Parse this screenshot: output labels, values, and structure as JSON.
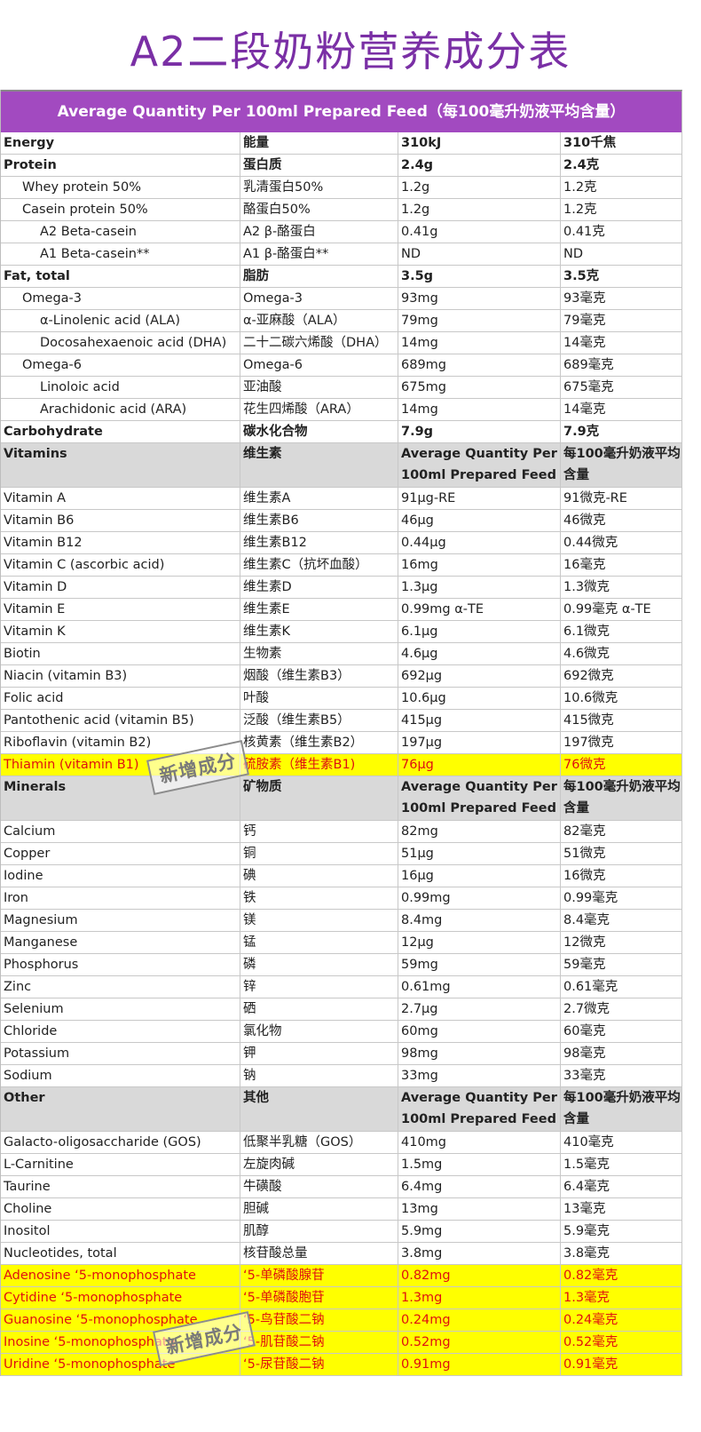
{
  "title": "A2二段奶粉营养成分表",
  "header": "Average Quantity Per 100ml Prepared Feed（每100毫升奶液平均含量）",
  "stamp": "新增成分",
  "rows": [
    {
      "en": "Energy",
      "cn": "能量",
      "v1": "310kJ",
      "v2": "310千焦",
      "bold": true
    },
    {
      "en": "Protein",
      "cn": "蛋白质",
      "v1": "2.4g",
      "v2": "2.4克",
      "bold": true
    },
    {
      "en": "Whey protein 50%",
      "cn": "乳清蛋白50%",
      "v1": "1.2g",
      "v2": "1.2克",
      "indent": 1
    },
    {
      "en": "Casein protein 50%",
      "cn": "酪蛋白50%",
      "v1": "1.2g",
      "v2": "1.2克",
      "indent": 1
    },
    {
      "en": "A2 Beta-casein",
      "cn": "A2 β-酪蛋白",
      "v1": "0.41g",
      "v2": "0.41克",
      "indent": 2
    },
    {
      "en": "A1 Beta-casein**",
      "cn": "A1 β-酪蛋白**",
      "v1": "ND",
      "v2": "ND",
      "indent": 2
    },
    {
      "en": "Fat, total",
      "cn": "脂肪",
      "v1": "3.5g",
      "v2": "3.5克",
      "bold": true
    },
    {
      "en": "Omega-3",
      "cn": "Omega-3",
      "v1": "93mg",
      "v2": "93毫克",
      "indent": 1
    },
    {
      "en": "α-Linolenic acid (ALA)",
      "cn": "α-亚麻酸（ALA）",
      "v1": "79mg",
      "v2": "79毫克",
      "indent": 2
    },
    {
      "en": "Docosahexaenoic acid (DHA)",
      "cn": "二十二碳六烯酸（DHA）",
      "v1": "14mg",
      "v2": "14毫克",
      "indent": 2
    },
    {
      "en": "Omega-6",
      "cn": "Omega-6",
      "v1": "689mg",
      "v2": "689毫克",
      "indent": 1
    },
    {
      "en": "Linoloic acid",
      "cn": "亚油酸",
      "v1": "675mg",
      "v2": "675毫克",
      "indent": 2
    },
    {
      "en": "Arachidonic acid (ARA)",
      "cn": "花生四烯酸（ARA）",
      "v1": "14mg",
      "v2": "14毫克",
      "indent": 2
    },
    {
      "en": "Carbohydrate",
      "cn": "碳水化合物",
      "v1": "7.9g",
      "v2": "7.9克",
      "bold": true
    },
    {
      "en": "Vitamins",
      "cn": "维生素",
      "v1": "Average Quantity Per 100ml Prepared Feed",
      "v2": "每100毫升奶液平均含量",
      "section": true
    },
    {
      "en": "Vitamin A",
      "cn": "维生素A",
      "v1": "91μg-RE",
      "v2": "91微克-RE"
    },
    {
      "en": "Vitamin B6",
      "cn": "维生素B6",
      "v1": "46μg",
      "v2": "46微克"
    },
    {
      "en": "Vitamin B12",
      "cn": "维生素B12",
      "v1": "0.44μg",
      "v2": "0.44微克"
    },
    {
      "en": "Vitamin C (ascorbic acid)",
      "cn": "维生素C（抗坏血酸）",
      "v1": "16mg",
      "v2": "16毫克"
    },
    {
      "en": "Vitamin D",
      "cn": "维生素D",
      "v1": "1.3μg",
      "v2": "1.3微克"
    },
    {
      "en": "Vitamin E",
      "cn": "维生素E",
      "v1": "0.99mg α-TE",
      "v2": "0.99毫克 α-TE"
    },
    {
      "en": "Vitamin K",
      "cn": "维生素K",
      "v1": "6.1μg",
      "v2": "6.1微克"
    },
    {
      "en": "Biotin",
      "cn": "生物素",
      "v1": "4.6μg",
      "v2": "4.6微克"
    },
    {
      "en": "Niacin (vitamin B3)",
      "cn": "烟酸（维生素B3）",
      "v1": "692μg",
      "v2": "692微克"
    },
    {
      "en": "Folic acid",
      "cn": "叶酸",
      "v1": "10.6μg",
      "v2": "10.6微克"
    },
    {
      "en": "Pantothenic acid (vitamin B5)",
      "cn": "泛酸（维生素B5）",
      "v1": "415μg",
      "v2": "415微克"
    },
    {
      "en": "Riboflavin (vitamin B2)",
      "cn": "核黄素（维生素B2）",
      "v1": "197μg",
      "v2": "197微克"
    },
    {
      "en": "Thiamin (vitamin B1)",
      "cn": "硫胺素（维生素B1)",
      "v1": "76μg",
      "v2": "76微克",
      "highlight": true
    },
    {
      "en": "Minerals",
      "cn": "矿物质",
      "v1": "Average Quantity Per 100ml Prepared Feed",
      "v2": "每100毫升奶液平均含量",
      "section": true
    },
    {
      "en": "Calcium",
      "cn": "钙",
      "v1": "82mg",
      "v2": "82毫克"
    },
    {
      "en": "Copper",
      "cn": "铜",
      "v1": "51μg",
      "v2": "51微克"
    },
    {
      "en": "Iodine",
      "cn": "碘",
      "v1": "16μg",
      "v2": "16微克"
    },
    {
      "en": "Iron",
      "cn": "铁",
      "v1": "0.99mg",
      "v2": "0.99毫克"
    },
    {
      "en": "Magnesium",
      "cn": "镁",
      "v1": "8.4mg",
      "v2": "8.4毫克"
    },
    {
      "en": "Manganese",
      "cn": "锰",
      "v1": "12μg",
      "v2": "12微克"
    },
    {
      "en": "Phosphorus",
      "cn": "磷",
      "v1": "59mg",
      "v2": "59毫克"
    },
    {
      "en": "Zinc",
      "cn": "锌",
      "v1": "0.61mg",
      "v2": "0.61毫克"
    },
    {
      "en": "Selenium",
      "cn": "硒",
      "v1": "2.7μg",
      "v2": "2.7微克"
    },
    {
      "en": "Chloride",
      "cn": "氯化物",
      "v1": "60mg",
      "v2": "60毫克"
    },
    {
      "en": "Potassium",
      "cn": "钾",
      "v1": "98mg",
      "v2": "98毫克"
    },
    {
      "en": "Sodium",
      "cn": "钠",
      "v1": "33mg",
      "v2": "33毫克"
    },
    {
      "en": "Other",
      "cn": "其他",
      "v1": "Average Quantity Per 100ml Prepared Feed",
      "v2": "每100毫升奶液平均含量",
      "section": true
    },
    {
      "en": "Galacto-oligosaccharide (GOS)",
      "cn": "低聚半乳糖（GOS）",
      "v1": "410mg",
      "v2": "410毫克"
    },
    {
      "en": "L-Carnitine",
      "cn": "左旋肉碱",
      "v1": "1.5mg",
      "v2": "1.5毫克"
    },
    {
      "en": "Taurine",
      "cn": "牛磺酸",
      "v1": "6.4mg",
      "v2": "6.4毫克"
    },
    {
      "en": "Choline",
      "cn": "胆碱",
      "v1": "13mg",
      "v2": "13毫克"
    },
    {
      "en": "Inositol",
      "cn": "肌醇",
      "v1": "5.9mg",
      "v2": "5.9毫克"
    },
    {
      "en": "Nucleotides, total",
      "cn": "核苷酸总量",
      "v1": "3.8mg",
      "v2": "3.8毫克"
    },
    {
      "en": "Adenosine ‘5-monophosphate",
      "cn": "‘5-单磷酸腺苷",
      "v1": "0.82mg",
      "v2": "0.82毫克",
      "highlight": true
    },
    {
      "en": "Cytidine ‘5-monophosphate",
      "cn": "‘5-单磷酸胞苷",
      "v1": "1.3mg",
      "v2": "1.3毫克",
      "highlight": true
    },
    {
      "en": "Guanosine ‘5-monophosphate",
      "cn": "‘5-鸟苷酸二钠",
      "v1": "0.24mg",
      "v2": "0.24毫克",
      "highlight": true
    },
    {
      "en": "Inosine ‘5-monophosphate",
      "cn": "‘5-肌苷酸二钠",
      "v1": "0.52mg",
      "v2": "0.52毫克",
      "highlight": true
    },
    {
      "en": "Uridine ‘5-monophosphate",
      "cn": "‘5-尿苷酸二钠",
      "v1": "0.91mg",
      "v2": "0.91毫克",
      "highlight": true
    }
  ]
}
